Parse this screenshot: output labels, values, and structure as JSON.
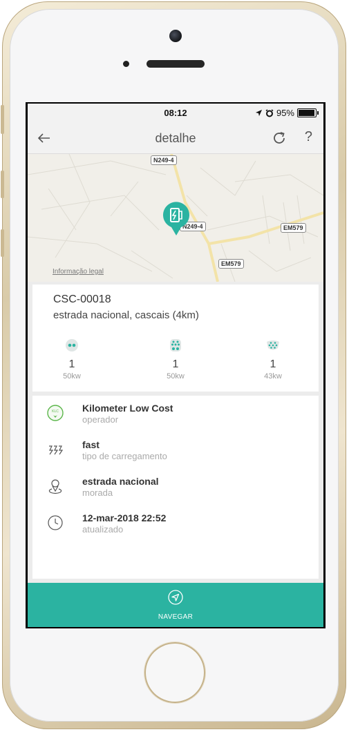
{
  "status_bar": {
    "time": "08:12",
    "battery": "95%",
    "battery_level": 0.95
  },
  "nav": {
    "title": "detalhe",
    "help_label": "?"
  },
  "map": {
    "legal_link": "Informação legal",
    "road_labels": [
      "N249-4",
      "N249-4",
      "EM579",
      "EM579"
    ]
  },
  "station": {
    "code": "CSC-00018",
    "address": "estrada nacional, cascais (4km)"
  },
  "connectors": [
    {
      "count": "1",
      "power": "50kw"
    },
    {
      "count": "1",
      "power": "50kw"
    },
    {
      "count": "1",
      "power": "43kw"
    }
  ],
  "details": [
    {
      "value": "Kilometer Low Cost",
      "label": "operador",
      "icon": "operator-logo-icon"
    },
    {
      "value": "fast",
      "label": "tipo de carregamento",
      "icon": "lightning-icon"
    },
    {
      "value": "estrada nacional",
      "label": "morada",
      "icon": "location-icon"
    },
    {
      "value": "12-mar-2018 22:52",
      "label": "atualizado",
      "icon": "clock-icon"
    }
  ],
  "operator_logo_text": "KLC",
  "action": {
    "navigate_label": "NAVEGAR"
  },
  "colors": {
    "accent": "#2bb3a1"
  }
}
